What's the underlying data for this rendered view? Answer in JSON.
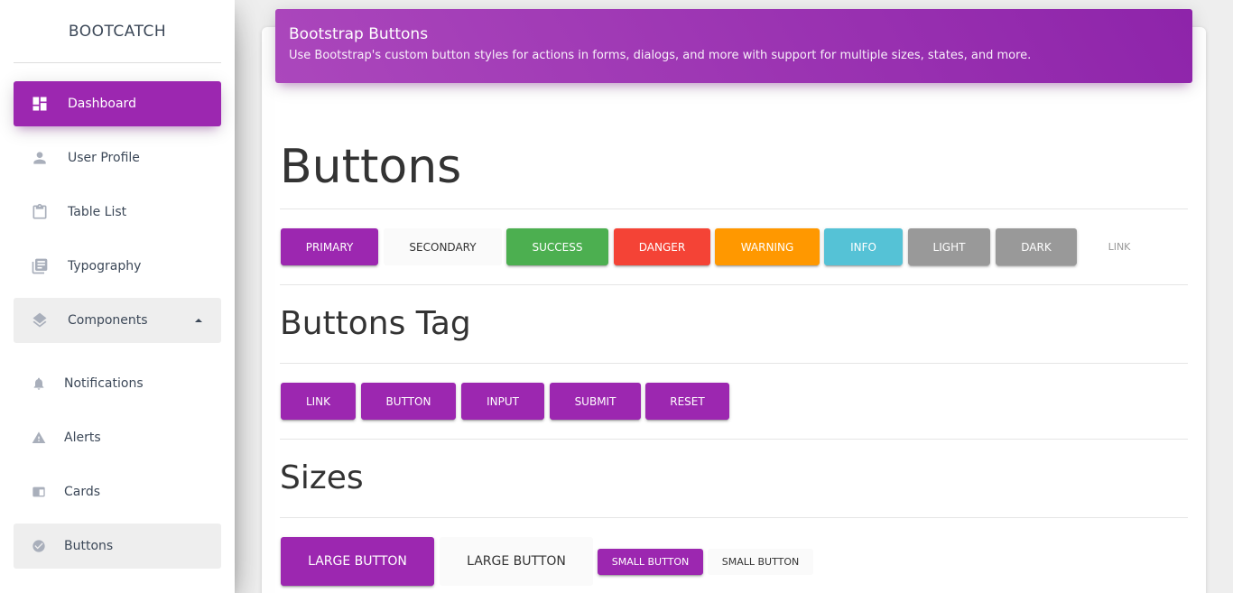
{
  "sidebar": {
    "brand": "BOOTCATCH",
    "items": [
      {
        "label": "Dashboard",
        "icon": "dashboard-icon"
      },
      {
        "label": "User Profile",
        "icon": "person-icon"
      },
      {
        "label": "Table List",
        "icon": "clipboard-icon"
      },
      {
        "label": "Typography",
        "icon": "library-books-icon"
      },
      {
        "label": "Components",
        "icon": "layers-icon"
      },
      {
        "label": "Notifications",
        "icon": "bell-icon"
      },
      {
        "label": "Alerts",
        "icon": "warning-icon"
      },
      {
        "label": "Cards",
        "icon": "card-icon"
      },
      {
        "label": "Buttons",
        "icon": "check-circle-icon"
      }
    ]
  },
  "header": {
    "title": "Bootstrap Buttons",
    "subtitle": "Use Bootstrap's custom button styles for actions in forms, dialogs, and more with support for multiple sizes, states, and more."
  },
  "sections": {
    "buttons": {
      "heading": "Buttons",
      "items": [
        "PRIMARY",
        "SECONDARY",
        "SUCCESS",
        "DANGER",
        "WARNING",
        "INFO",
        "LIGHT",
        "DARK",
        "LINK"
      ]
    },
    "tags": {
      "heading": "Buttons Tag",
      "items": [
        "LINK",
        "BUTTON",
        "INPUT",
        "SUBMIT",
        "RESET"
      ]
    },
    "sizes": {
      "heading": "Sizes",
      "items": [
        "LARGE BUTTON",
        "LARGE BUTTON",
        "SMALL BUTTON",
        "SMALL BUTTON"
      ]
    }
  },
  "colors": {
    "primary": "#9c27b0",
    "success": "#4caf50",
    "danger": "#f44336",
    "warning": "#ff9800",
    "info": "#55c2d6",
    "grey": "#999999",
    "secondary_bg": "#fafafa"
  }
}
